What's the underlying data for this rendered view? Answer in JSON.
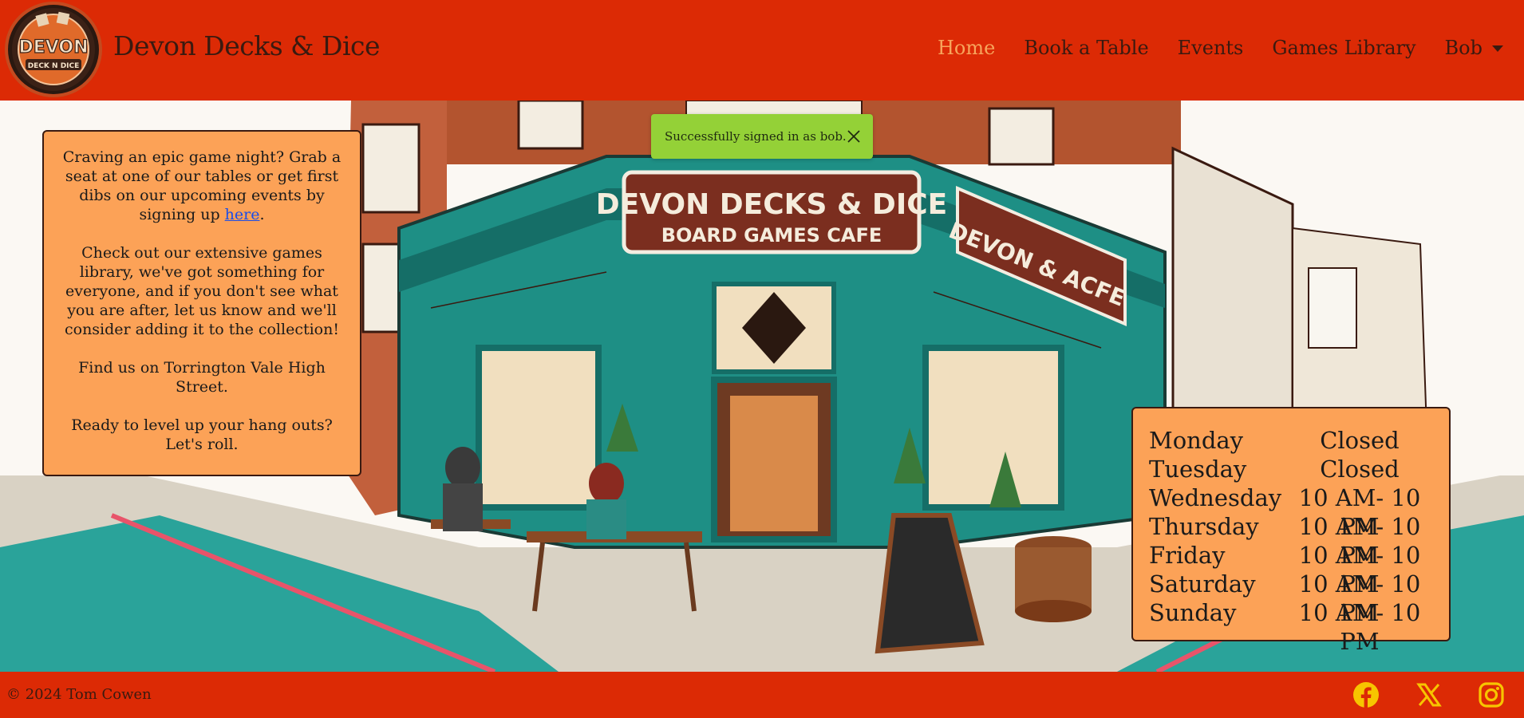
{
  "brand": {
    "name": "Devon Decks & Dice",
    "logo_text_top": "DEVON",
    "logo_text_bottom": "DECK N DICE"
  },
  "nav": {
    "items": [
      {
        "label": "Home",
        "active": true
      },
      {
        "label": "Book a Table",
        "active": false
      },
      {
        "label": "Events",
        "active": false
      },
      {
        "label": "Games Library",
        "active": false
      }
    ],
    "user": "Bob"
  },
  "toast": {
    "message": "Successfully signed in as bob."
  },
  "info": {
    "p1_before": "Craving an epic game night? Grab a seat at one of our tables or get first dibs on our upcoming events by signing up ",
    "p1_link": "here",
    "p1_after": ".",
    "p2": "Check out our extensive games library, we've got something for everyone, and if you don't see what you are after, let us know and we'll consider adding it to the collection!",
    "p3": "Find us on Torrington Vale High Street.",
    "p4": "Ready to level up your hang outs? Let's roll."
  },
  "hours": [
    {
      "day": "Monday",
      "time": "Closed"
    },
    {
      "day": "Tuesday",
      "time": "Closed"
    },
    {
      "day": "Wednesday",
      "time": "10 AM- 10 PM"
    },
    {
      "day": "Thursday",
      "time": "10 AM- 10 PM"
    },
    {
      "day": "Friday",
      "time": "10 AM- 10 PM"
    },
    {
      "day": "Saturday",
      "time": "10 AM- 10 PM"
    },
    {
      "day": "Sunday",
      "time": "10 AM- 10 PM"
    }
  ],
  "hero": {
    "sign_line1": "DEVON DECKS & DICE",
    "sign_line2": "BOARD GAMES CAFE",
    "side_sign": "DEVON & ACFE"
  },
  "footer": {
    "copyright": "© 2024 Tom Cowen",
    "social": [
      "facebook-icon",
      "x-twitter-icon",
      "instagram-icon"
    ]
  },
  "colors": {
    "primary_red": "#dc2a05",
    "card_orange": "#fca257",
    "nav_active": "#f7a55c",
    "toast_green": "#94d137",
    "text_dark": "#3a1a10",
    "social_yellow": "#f7c500"
  }
}
